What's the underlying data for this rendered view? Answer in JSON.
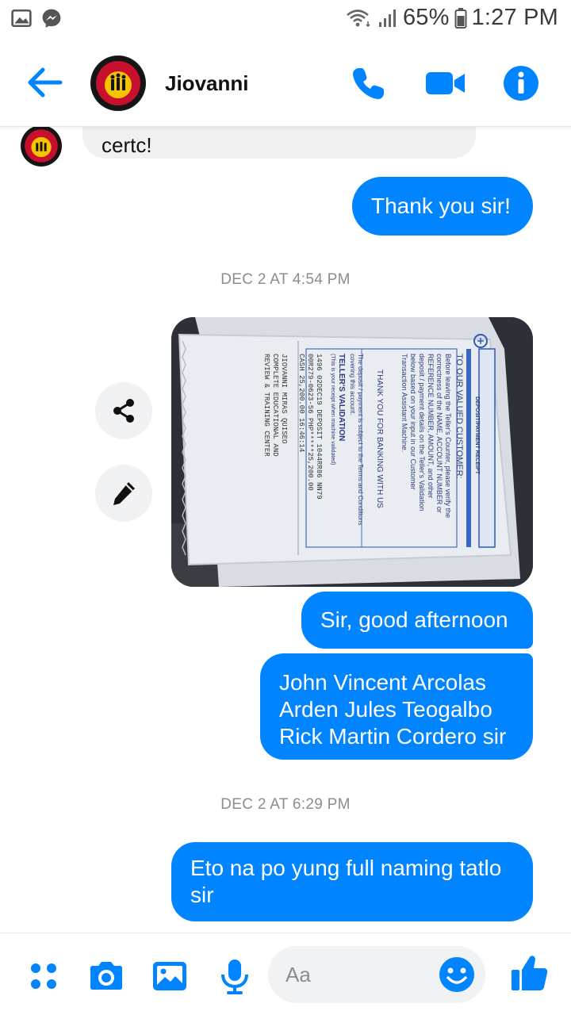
{
  "status_bar": {
    "battery": "65%",
    "time": "1:27 PM"
  },
  "header": {
    "contact_name": "Jiovanni",
    "icons": [
      "back-arrow-icon",
      "phone-icon",
      "video-camera-icon",
      "info-icon"
    ]
  },
  "colors": {
    "accent": "#0084ff",
    "incoming_bubble": "#f1f0f0",
    "timestamp": "#8a8d91"
  },
  "messages": {
    "incoming_partial": "certc!",
    "thank_you": "Thank you sir!",
    "timestamp_1": "DEC 2 AT 4:54 PM",
    "greeting": "Sir, good afternoon",
    "names": {
      "line1": "John Vincent Arcolas",
      "line2": "Arden Jules Teogalbo",
      "line3": "Rick Martin Cordero sir"
    },
    "timestamp_2": "DEC 2 AT 6:29 PM",
    "last": {
      "line1": "Eto na po yung full naming tatlo",
      "line2": "sir"
    }
  },
  "receipt": {
    "heading": "TO OUR VALUED CUSTOMER:",
    "body": [
      "Before leaving the Teller's Counter, please verify the",
      "correctness of the NAME, ACCOUNT NUMBER or",
      "REFERENCE NUMBER, AMOUNT, and other",
      "deposit / payment details on the Teller's Validation",
      "below based on your input in our Customer",
      "Transaction Assistant Machine."
    ],
    "thanks": "THANK YOU FOR BANKING WITH US",
    "terms": [
      "The deposit / payment is subject to the Terms and Conditions",
      "covering this account."
    ],
    "validation_title": "TELLER'S VALIDATION",
    "validation_sub": "(This is your receipt when machine validated)",
    "lines": [
      "1496      02DEC19  DEPOSIT   1044RR86 NN79",
      "00R279-0623-56 PHP*****25,200.00",
      "CASH      25,200.00         16:46:14",
      "JIOVANNI MIRAS QUISEO",
      "COMPLETE EDUCATIONAL AND",
      "REVIEW & TRAINING CENTER"
    ],
    "side_label": "DEPOSIT/PAYMENT RECEIPT"
  },
  "actions": {
    "share_icon": "share-icon",
    "edit_icon": "pencil-icon"
  },
  "composer": {
    "placeholder": "Aa",
    "icons": [
      "menu-dots-icon",
      "camera-icon",
      "gallery-icon",
      "microphone-icon",
      "emoji-icon",
      "thumbs-up-icon"
    ]
  }
}
